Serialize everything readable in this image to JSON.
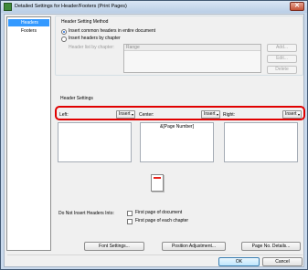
{
  "window": {
    "title": "Detailed Settings for Header/Footers (Print Pages)",
    "close_glyph": "✕"
  },
  "sidebar": {
    "items": [
      {
        "label": "Headers",
        "active": true
      },
      {
        "label": "Footers",
        "active": false
      }
    ]
  },
  "header_method": {
    "legend": "Header Setting Method",
    "option_common": "Insert common headers in entire document",
    "option_chapter": "Insert headers by chapter",
    "list_label": "Header list by chapter:",
    "list_column": "Range",
    "buttons": {
      "add": "Add...",
      "edit": "Edit...",
      "delete": "Delete"
    }
  },
  "header_settings": {
    "legend": "Header Settings",
    "left_label": "Left:",
    "center_label": "Center:",
    "right_label": "Right:",
    "insert_label": "Insert",
    "insert_arrow": "▾",
    "left_text": "",
    "center_text": "&[Page Number]",
    "right_text": ""
  },
  "do_not_insert": {
    "label": "Do Not Insert Headers Into:",
    "first_page_document": "First page of document",
    "first_page_chapter": "First page of each chapter"
  },
  "buttons": {
    "font_settings": "Font Settings...",
    "position_adjustment": "Position Adjustment...",
    "page_no_details": "Page No. Details...",
    "ok": "OK",
    "cancel": "Cancel"
  },
  "colors": {
    "highlight": "#e00000",
    "selection": "#3399ff"
  }
}
